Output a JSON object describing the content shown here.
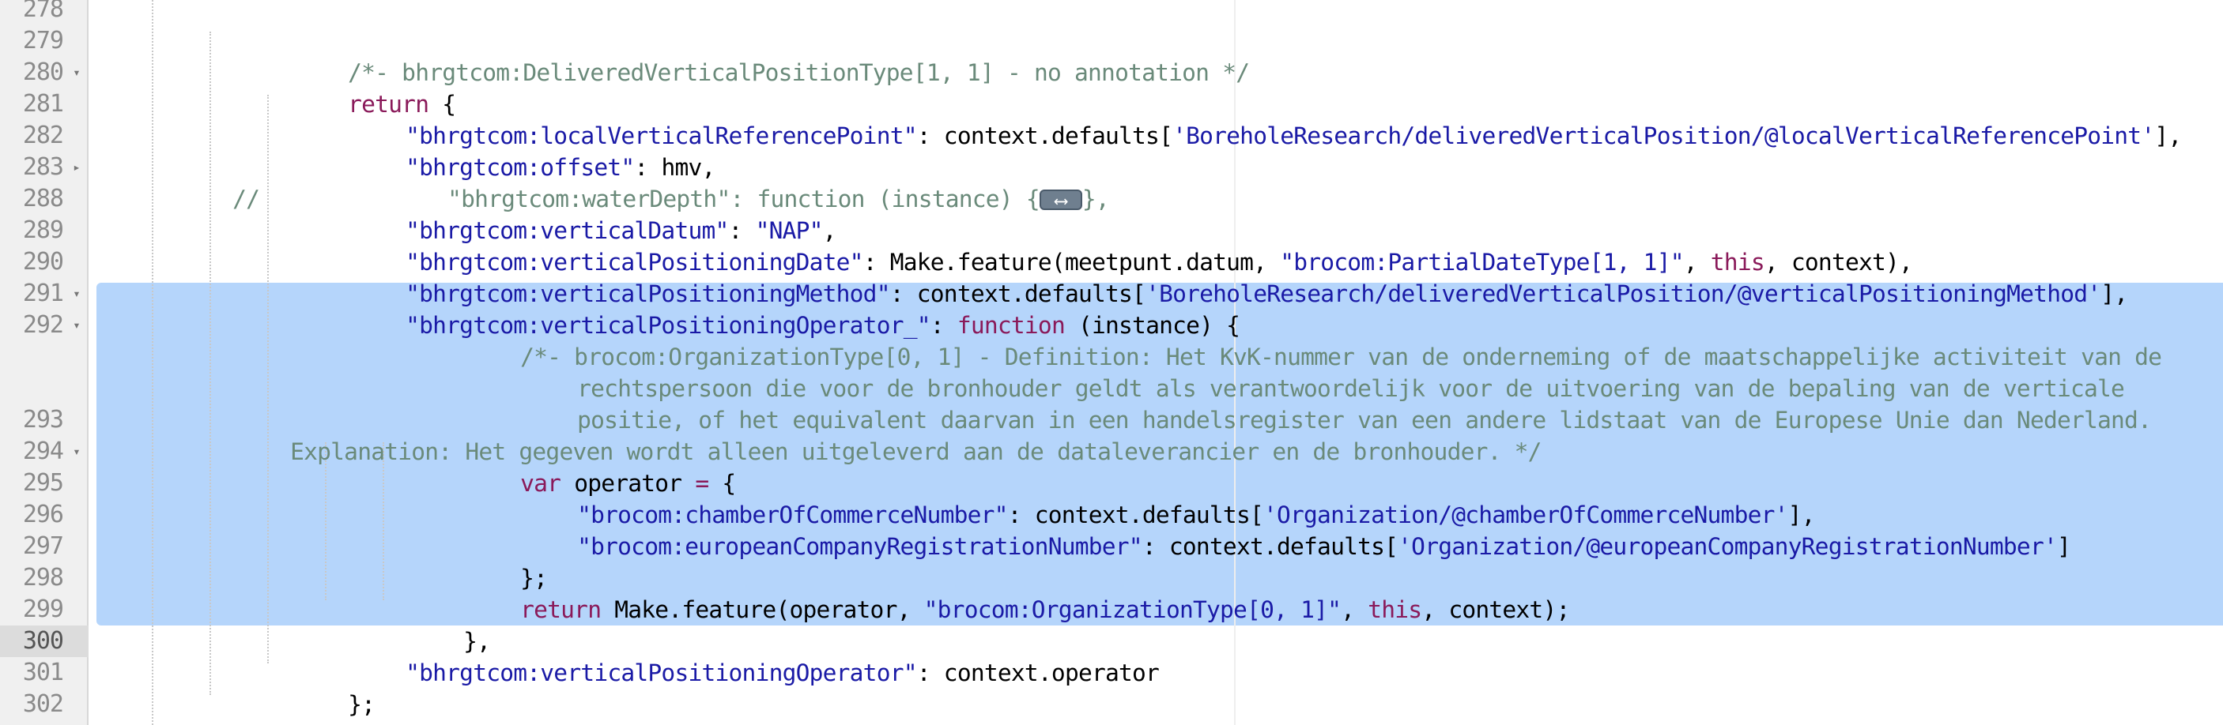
{
  "editor": {
    "lines": [
      {
        "num": "278",
        "fold": "",
        "text": ""
      },
      {
        "num": "279",
        "fold": "",
        "text": "/*- bhrgtcom:DeliveredVerticalPositionType[1, 1] - no annotation */"
      },
      {
        "num": "280",
        "fold": "▾",
        "text": "return {"
      },
      {
        "num": "281",
        "fold": "",
        "key": "\"bhrgtcom:localVerticalReferencePoint\"",
        "mid": ": context.defaults[",
        "str": "'BoreholeResearch/deliveredVerticalPosition/@localVerticalReferencePoint'",
        "end": "],"
      },
      {
        "num": "282",
        "fold": "",
        "key": "\"bhrgtcom:offset\"",
        "mid": ": hmv,"
      },
      {
        "num": "283",
        "fold": "▸",
        "prefix": "//",
        "text": "\"bhrgtcom:waterDepth\": function (instance) {",
        "end": "},"
      },
      {
        "num": "288",
        "fold": "",
        "key": "\"bhrgtcom:verticalDatum\"",
        "mid": ": ",
        "str": "\"NAP\"",
        "end": ","
      },
      {
        "num": "289",
        "fold": "",
        "key": "\"bhrgtcom:verticalPositioningDate\"",
        "mid": ": Make.feature(meetpunt.datum, ",
        "str": "\"brocom:PartialDateType[1, 1]\"",
        "sep": ", ",
        "kw": "this",
        "end": ", context),"
      },
      {
        "num": "290",
        "fold": "",
        "key": "\"bhrgtcom:verticalPositioningMethod\"",
        "mid": ": context.defaults[",
        "str": "'BoreholeResearch/deliveredVerticalPosition/@verticalPositioningMethod'",
        "end": "],"
      },
      {
        "num": "291",
        "fold": "▾",
        "key": "\"bhrgtcom:verticalPositioningOperator_\"",
        "mid": ": ",
        "kw": "function",
        "end": " (instance) {"
      },
      {
        "num": "292",
        "fold": "▾",
        "text": "/*- brocom:OrganizationType[0, 1] - Definition: Het KvK-nummer van de onderneming of de maatschappelijke activiteit van de"
      },
      {
        "num": "",
        "fold": "",
        "text": "rechtspersoon die voor de bronhouder geldt als verantwoordelijk voor de uitvoering van de bepaling van de verticale"
      },
      {
        "num": "",
        "fold": "",
        "text": "positie, of het equivalent daarvan in een handelsregister van een andere lidstaat van de Europese Unie dan Nederland."
      },
      {
        "num": "293",
        "fold": "",
        "text": "Explanation: Het gegeven wordt alleen uitgeleverd aan de dataleverancier en de bronhouder. */"
      },
      {
        "num": "294",
        "fold": "▾",
        "kw": "var",
        "mid": " operator ",
        "op": "=",
        "end": " {"
      },
      {
        "num": "295",
        "fold": "",
        "key": "\"brocom:chamberOfCommerceNumber\"",
        "mid": ": context.defaults[",
        "str": "'Organization/@chamberOfCommerceNumber'",
        "end": "],"
      },
      {
        "num": "296",
        "fold": "",
        "key": "\"brocom:europeanCompanyRegistrationNumber\"",
        "mid": ": context.defaults[",
        "str": "'Organization/@europeanCompanyRegistrationNumber'",
        "end": "]"
      },
      {
        "num": "297",
        "fold": "",
        "text": "};"
      },
      {
        "num": "298",
        "fold": "",
        "kw": "return",
        "mid": " Make.feature(operator, ",
        "str": "\"brocom:OrganizationType[0, 1]\"",
        "sep": ", ",
        "kw2": "this",
        "end": ", context);"
      },
      {
        "num": "299",
        "fold": "",
        "text": "},"
      },
      {
        "num": "300",
        "fold": "",
        "key": "\"bhrgtcom:verticalPositioningOperator\"",
        "mid": ": context.operator"
      },
      {
        "num": "301",
        "fold": "",
        "text": "};"
      },
      {
        "num": "302",
        "fold": "",
        "text": "},"
      }
    ],
    "colors": {
      "background": "#ffffff",
      "gutter": "#f0f0f0",
      "selection": "#b5d5fb",
      "comment": "#6a8a7a",
      "keyword": "#8a1a5a",
      "string": "#1a1aa6"
    },
    "icons": {
      "fold_open": "fold-open-icon",
      "fold_closed": "fold-closed-icon",
      "fold_widget": "fold-placeholder-icon"
    }
  }
}
